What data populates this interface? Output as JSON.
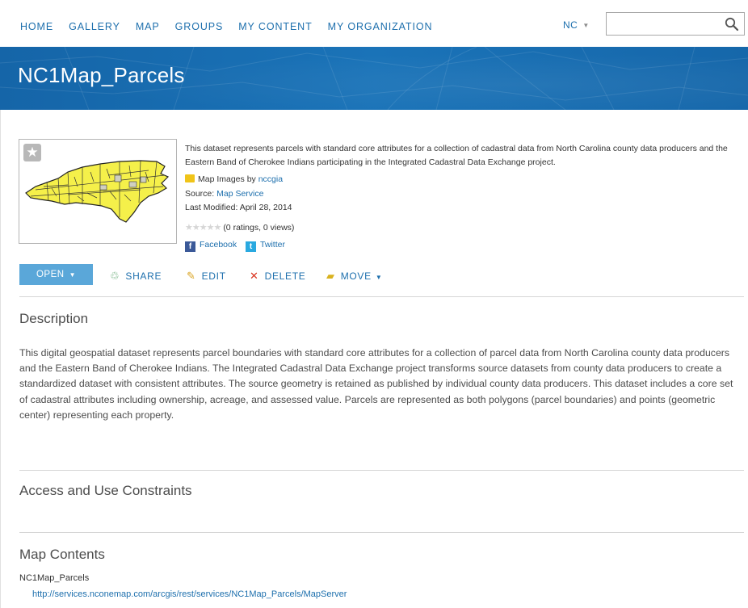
{
  "nav": {
    "links": [
      "HOME",
      "GALLERY",
      "MAP",
      "GROUPS",
      "MY CONTENT",
      "MY ORGANIZATION"
    ],
    "user": "NC",
    "search_placeholder": "",
    "search_value": ""
  },
  "banner": {
    "title": "NC1Map_Parcels"
  },
  "item": {
    "summary": "This dataset represents parcels with standard core attributes for a collection of cadastral data from North Carolina county data producers and the Eastern Band of Cherokee Indians participating in the Integrated Cadastral Data Exchange project.",
    "type_label": "Map Images by",
    "owner": "nccgia",
    "source_label": "Source:",
    "source_value": "Map Service",
    "modified": "Last Modified: April 28, 2014",
    "ratings": "(0 ratings, 0 views)",
    "rating_value": 0,
    "facebook": "Facebook",
    "twitter": "Twitter"
  },
  "actions": {
    "open": "OPEN",
    "share": "SHARE",
    "edit": "EDIT",
    "delete": "DELETE",
    "move": "MOVE"
  },
  "description": {
    "heading": "Description",
    "text": "This digital geospatial dataset represents parcel boundaries with standard core attributes for a collection of parcel data from North Carolina county data producers and the Eastern Band of Cherokee Indians. The Integrated Cadastral Data Exchange project transforms source datasets from county data producers to create a standardized dataset with consistent attributes. The source geometry is retained as published by individual county data producers. This dataset includes a core set of cadastral attributes including ownership, acreage, and assessed value. Parcels are represented as both polygons (parcel boundaries) and points (geometric center) representing each property."
  },
  "access": {
    "heading": "Access and Use Constraints"
  },
  "map_contents": {
    "heading": "Map Contents",
    "layer_name": "NC1Map_Parcels",
    "url": "http://services.nconemap.com/arcgis/rest/services/NC1Map_Parcels/MapServer"
  },
  "colors": {
    "link": "#1d6fad",
    "banner": "#1a6fb3",
    "open_button": "#5aa7d9",
    "delete_icon": "#d9331f"
  }
}
